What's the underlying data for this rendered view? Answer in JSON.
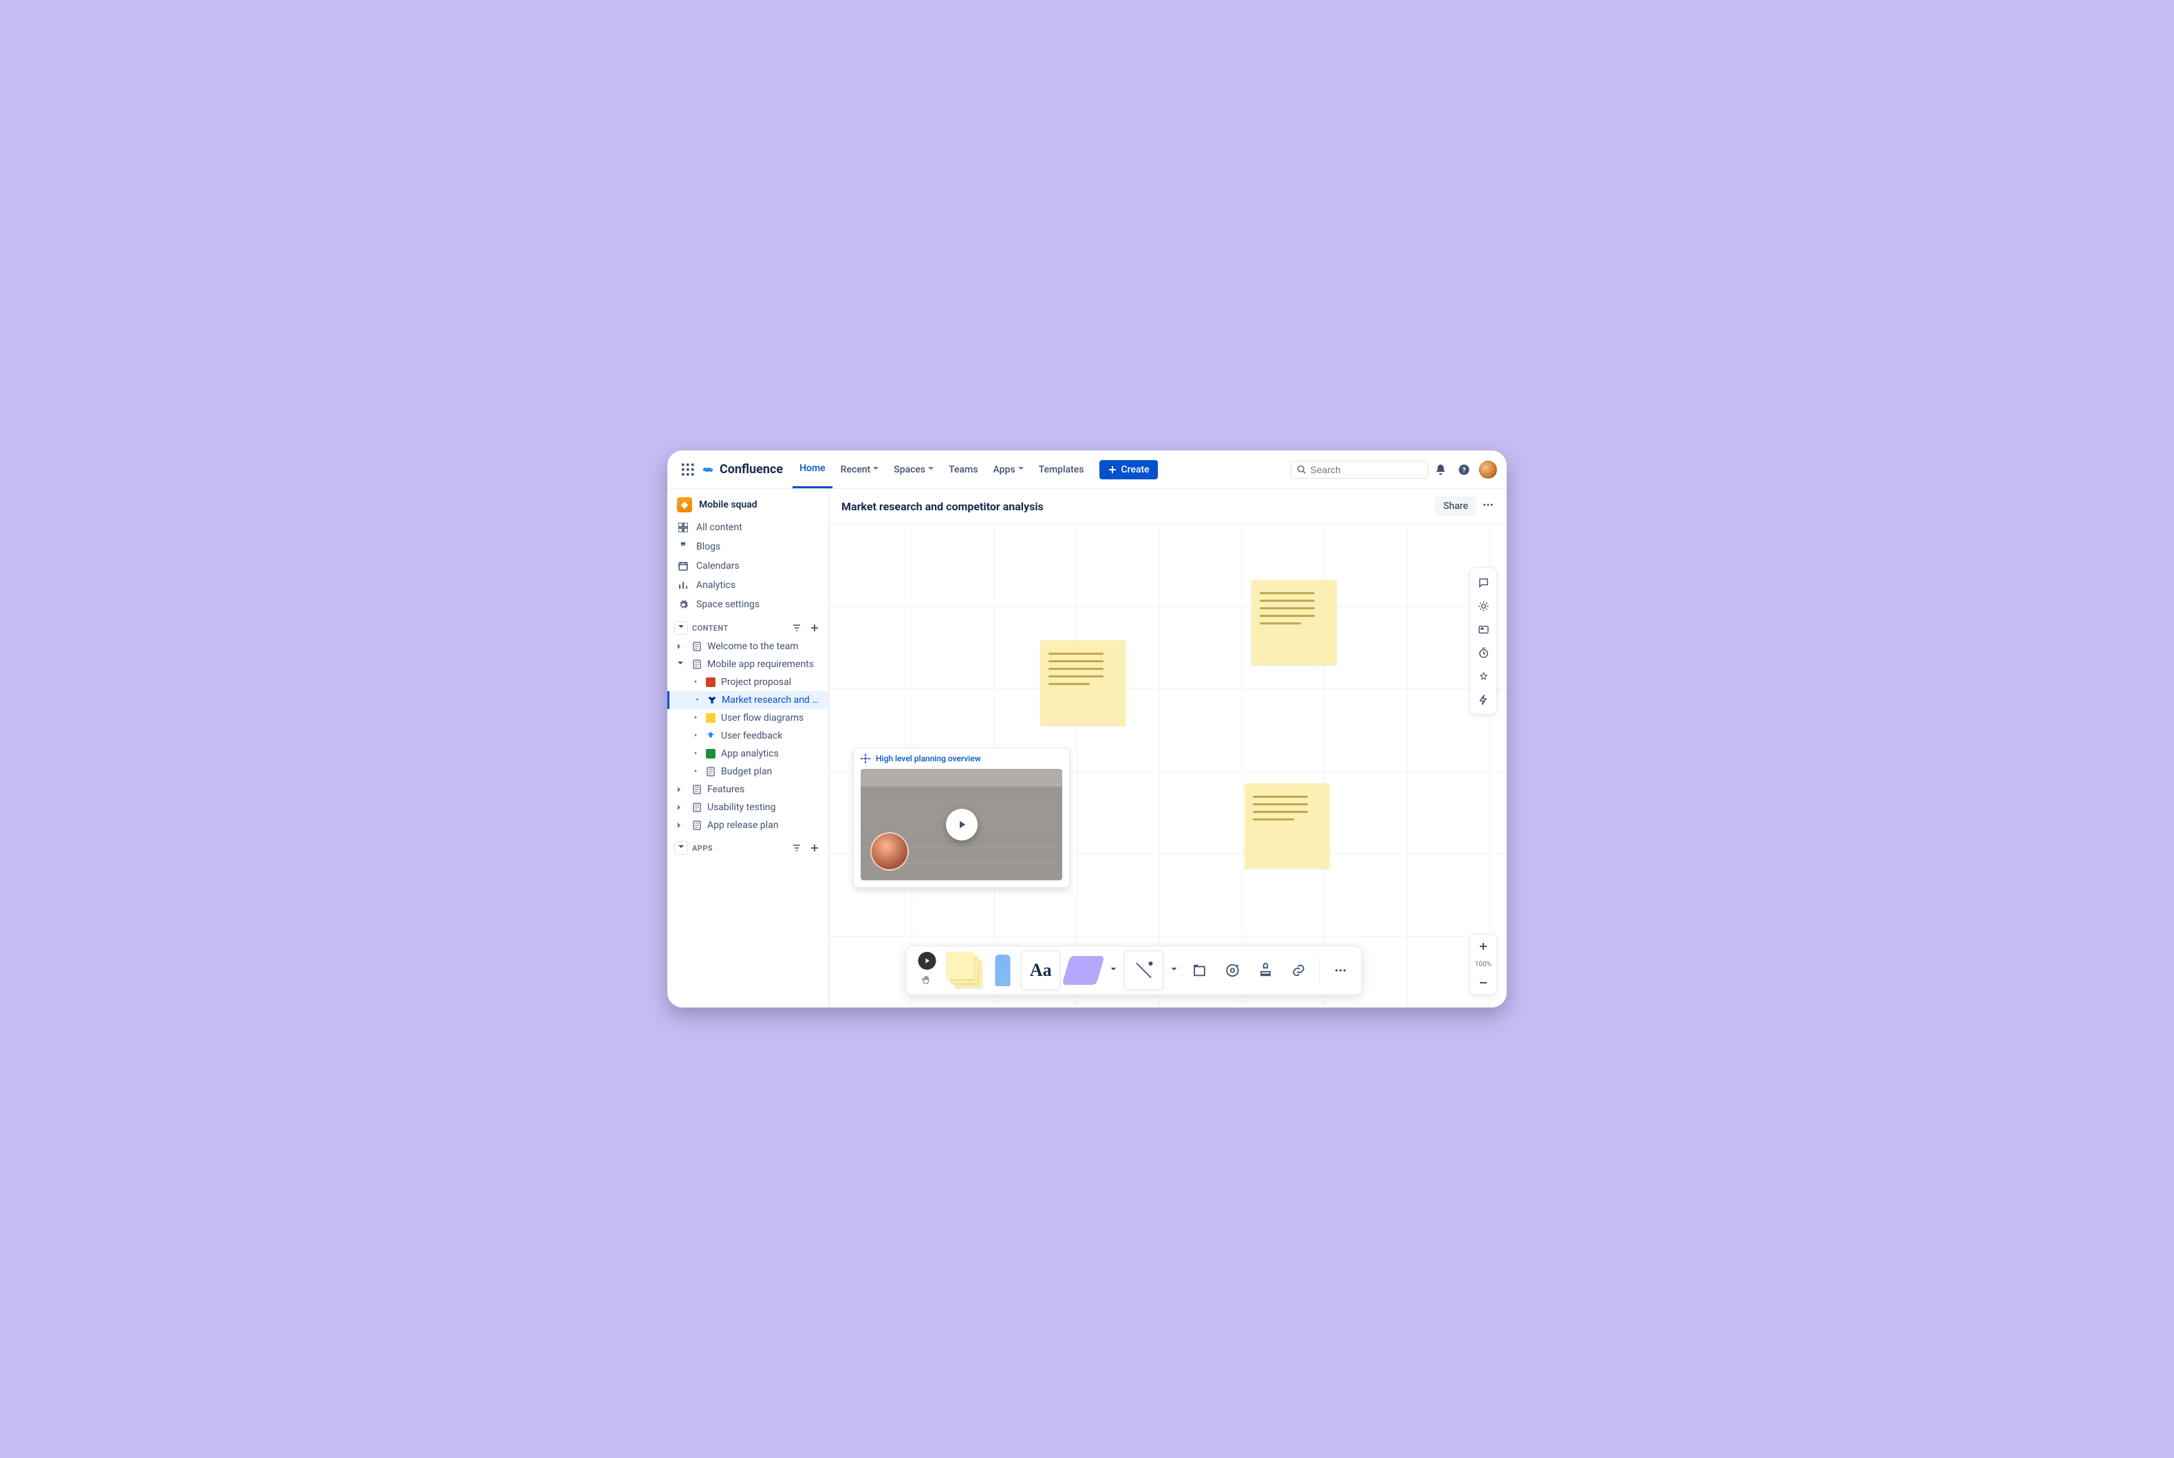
{
  "brand": "Confluence",
  "nav": {
    "home": "Home",
    "recent": "Recent",
    "spaces": "Spaces",
    "teams": "Teams",
    "apps": "Apps",
    "templates": "Templates",
    "create": "Create"
  },
  "search": {
    "placeholder": "Search"
  },
  "sidebar": {
    "space_name": "Mobile squad",
    "items": {
      "all_content": "All content",
      "blogs": "Blogs",
      "calendars": "Calendars",
      "analytics": "Analytics",
      "space_settings": "Space settings"
    },
    "sections": {
      "content": "CONTENT",
      "apps": "APPS"
    },
    "tree": {
      "welcome": "Welcome to the team",
      "mobile_app": "Mobile app requirements",
      "project_proposal": "Project proposal",
      "market_research": "Market research and co…",
      "user_flow": "User flow diagrams",
      "user_feedback": "User feedback",
      "app_analytics": "App analytics",
      "budget_plan": "Budget plan",
      "features": "Features",
      "usability": "Usability testing",
      "release_plan": "App release plan"
    }
  },
  "page": {
    "title": "Market research and competitor analysis",
    "share": "Share"
  },
  "video": {
    "title": "High level planning overview"
  },
  "zoom": {
    "label": "100%"
  }
}
